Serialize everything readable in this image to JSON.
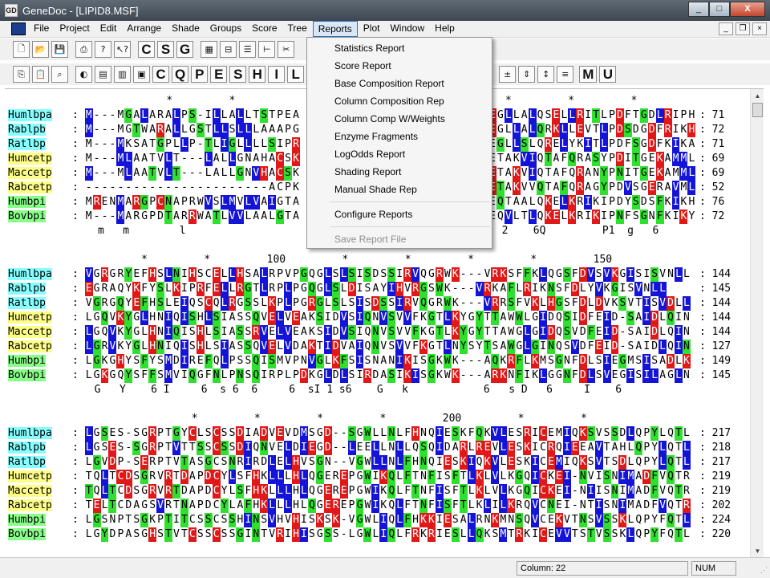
{
  "window": {
    "title": "GeneDoc - [LIPID8.MSF]",
    "app_icon": "GD",
    "min": "_",
    "max": "□",
    "close": "X"
  },
  "menus": [
    "File",
    "Project",
    "Edit",
    "Arrange",
    "Shade",
    "Groups",
    "Score",
    "Tree",
    "Reports",
    "Plot",
    "Window",
    "Help"
  ],
  "active_menu": "Reports",
  "toolbar1": {
    "icons": [
      "new-icon",
      "open-icon",
      "save-icon",
      "print-icon",
      "help-icon",
      "context-help-icon"
    ],
    "letters": [
      "C",
      "S",
      "G"
    ],
    "icons2": [
      "grid-icon",
      "seq-icon",
      "list-icon",
      "tree-icon",
      "scissors-icon"
    ]
  },
  "toolbar2": {
    "letters": [
      "C",
      "Q",
      "P",
      "E",
      "S",
      "H",
      "I",
      "L"
    ],
    "letters_right": [
      "M",
      "U"
    ]
  },
  "reports_menu": {
    "items": [
      "Statistics Report",
      "Score Report",
      "Base Composition Report",
      "Column Composition Rep",
      "Column Comp W/Weights",
      "Enzyme Fragments",
      "LogOdds Report",
      "Shading Report",
      "Manual Shade Rep"
    ],
    "configure": "Configure Reports",
    "disabled": "Save Report File"
  },
  "names": [
    "Humlbpa",
    "Rablpb",
    "Ratlbp",
    "Humcetp",
    "Maccetp",
    "Rabcetp",
    "Humbpi",
    "Bovbpi"
  ],
  "name_colors": [
    "#8ff",
    "#8ff",
    "#8ff",
    "#ff8",
    "#ff8",
    "#ff8",
    "#8f8",
    "#8f8"
  ],
  "blocks": [
    {
      "ruler": "               *         *                                           *         *         *",
      "left": [
        "M---MGALARALPS-ILLALLTSTPEA",
        "M---MGTWARALLGSTLLSLLLAAAPG",
        "M---MKSATGPLLP-TLIGLLLLSIPR",
        "M---MLAATVLT---LALLGNAHACSK",
        "M---MLAATVLT---LALLGNVHACSK",
        "-----------------------ACPK",
        "MRENMARGPCNAPRWVSLMVLVAIGTA",
        "M---MARGPDTARRWATLVVLAALGTA"
      ],
      "right": [
        "EGLLALQSELLRITLPDFTGDLRIPH",
        "EGLLALQRKLLEVTLPDSDGDFRIKH",
        "EGLLSLQRELYKITLPDFSGDFKIKA",
        "ETAKVIQTAFQRASYPDITGEKAMML",
        "ETAKVIQTAFQRANYPNITGEKAMML",
        "ETAKVVQTAFQRAGYPDVSGERAVML",
        "EQTAALQKELKRIKIPDYSDSFKIKH",
        "EQVLTLQKELKRIKIPNFSGNFKIKY"
      ],
      "nums": [
        "71",
        "72",
        "71",
        "69",
        "69",
        "52",
        "76",
        "72"
      ],
      "cons_left": "m   m        l",
      "cons_right": "  2    6Q         P1  g   6"
    },
    {
      "ruler": "           *         *         100         *         *         *         *         150",
      "seqs": [
        "VGRGRYEFHSLNIHSCELLHSALRPVPGQGLSLSISDSSIRVQGRWK---VRKSFFKLQGSFDVSVKGISISVNLL",
        "EGRAQYKFYSLKIPRFELLRGTLRPLPGQGLSLDISAYIHVRGSWK---VRKAFLRIKNSFDLYVKGISVNLL",
        "VGRGQYEFHSLEIQSCQLRGSSLKPLPGRGLSLSISDSSIRVQGRWK---VRRSFVKLHGSFDLDVKSVTISVDLL",
        "LGQVKYGLHNIQISHLSIASSQVELVEAKSIDVSIQNVSVVFKGTLKYGYTTAWWLGIDQSIDFEID-SAIDLQIN",
        "LGQVKYGLHNIQISHLSIASSRVELVEAKSIDVSIQNVSVVFKGTLKYGYTTAWGLGIDQSVDFEID-SAIDLQIN",
        "LGRVKYGLHNIQISHLSIASSQVELVDAKTIDVAIQNVSVVFKGTLNYSYTSAWGLGINQSVDFEID-SAIDLQIN",
        "LGKGHYSFYSMDIREFQLPSSQISMVPNVGLKFSISNANIKISGKWK---AQKRFLKMSGNFDLSIEGMSISADLK",
        "LGKGQYSFFSMVIQGFNLPNSQIRPLPDKGLDLSIRDASIKISGKWK---ARKNFIKLGGNFDLSVEGISILAGLN"
      ],
      "nums": [
        "144",
        "145",
        "144",
        "144",
        "144",
        "127",
        "149",
        "145"
      ],
      "cons": "  G   Y    6 I     6  s 6  6     6  sI 1 s6    G   k            6   s D   6     I    6"
    },
    {
      "ruler": "                   *         *         *         *         200         *         *",
      "seqs": [
        "LGSES-SGRPTGYCLSCSSDIADVEVDMSGD--SGWLLNLFHNQIESKFQKVLESRICEMIQKSVSSDLQPYLQTL",
        "LGSES-SGRPTVTTSSCSSDIQNVELDIEGD--LEELLNLLQSQIDARLREVLESKICRQIEEAVTAHLQPYLQTL",
        "LGVDP-SERPTVTASGCSNRIRDLELHVSGN--VGWLLNLFHNQIESKIQKVLESKICEMIQKSVTSDLQPYLQTL",
        "TQLTCDSGRVRTDAPDCYLSFHKLLLHLQGEREPGWIKQLFTNFISFTLKLVLKGQICKEI-NVISNIMADFVQTR",
        "TQLTCDSGRVRTDAPDCYLSFHKLLLHLQGEREPGWIKQLFTNFISFTLKLVLKGQICKEI-NIISNIMADFVQTR",
        "TELTCDAGSVRTNAPDCYLAFHKLLLHLQGEREPGWIKQLFTNFISFTLKLILKRQVCNEI-NTISNIMADFVQTR",
        "LGSNPTSGKPTITCSSCSSHINSVHVHISKSK-VGWLIQLFHKKIESALRNKMNSQVCEKVTNSVSSKLQPYFQTL",
        "LGYDPASGHSTVTCSSCSSGINTVRIHISGSS-LGWLIQLFRKRIESLLQKSMTRKICEVVTSTVSSKLQPYFQTL"
      ],
      "nums": [
        "217",
        "218",
        "217",
        "219",
        "219",
        "202",
        "224",
        "220"
      ]
    }
  ],
  "status": {
    "column": "Column: 22",
    "num": "NUM"
  }
}
